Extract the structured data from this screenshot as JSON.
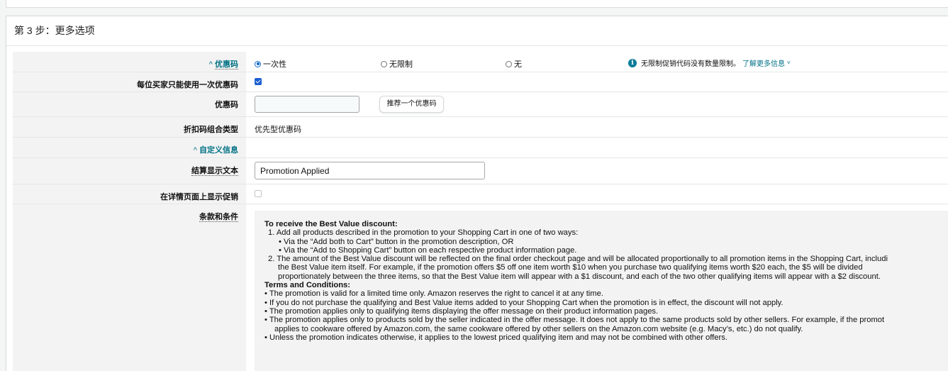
{
  "step_title": "第 3 步：更多选项",
  "promo_code_row": {
    "label": "优惠码",
    "label_prefix": "^",
    "options": [
      {
        "label": "一次性",
        "selected": true
      },
      {
        "label": "无限制",
        "selected": false
      },
      {
        "label": "无",
        "selected": false
      }
    ],
    "info_text": "无限制促销代码没有数量限制。",
    "learn_more": "了解更多信息",
    "learn_more_icon": "chevron-down-icon"
  },
  "once_per_buyer": {
    "label": "每位买家只能使用一次优惠码",
    "checked": true
  },
  "code_field": {
    "label": "优惠码",
    "value": "",
    "suggest_button": "推荐一个优惠码"
  },
  "combination_type": {
    "label": "折扣码组合类型",
    "value": "优先型优惠码"
  },
  "custom_info": {
    "label": "自定义信息",
    "label_prefix": "^"
  },
  "checkout_text": {
    "label": "结算显示文本",
    "value": "Promotion Applied"
  },
  "show_on_detail": {
    "label": "在详情页面上显示促销",
    "checked": false
  },
  "terms": {
    "label": "条款和条件",
    "lines": [
      "To receive the Best Value discount:",
      "1. Add all products described in the promotion to your Shopping Cart in one of two ways:",
      "• Via the “Add both to Cart” button in the promotion description, OR",
      "• Via the “Add to Shopping Cart” button on each respective product information page.",
      "2. The amount of the Best Value discount will be reflected on the final order checkout page and will be allocated proportionally to all promotion items in the Shopping Cart, includi",
      "the Best Value item itself. For example, if the promotion offers $5 off one item worth $10 when you purchase two qualifying items worth $20 each, the $5 will be divided",
      "proportionately between the three items, so that the Best Value item will appear with a $1 discount, and each of the two other qualifying items will appear with a $2 discount.",
      "Terms and Conditions:",
      "• The promotion is valid for a limited time only. Amazon reserves the right to cancel it at any time.",
      "• If you do not purchase the qualifying and Best Value items added to your Shopping Cart when the promotion is in effect, the discount will not apply.",
      "• The promotion applies only to qualifying items displaying the offer message on their product information pages.",
      "• The promotion applies only to products sold by the seller indicated in the offer message. It does not apply to the same products sold by other sellers. For example, if the promot",
      "applies to cookware offered by Amazon.com, the same cookware offered by other sellers on the Amazon.com website (e.g. Macy’s, etc.) do not qualify.",
      "• Unless the promotion indicates otherwise, it applies to the lowest priced qualifying item and may not be combined with other offers."
    ]
  },
  "colors": {
    "accent": "#0a66c2",
    "link": "#007185",
    "label_bg": "#f3f3f3"
  }
}
